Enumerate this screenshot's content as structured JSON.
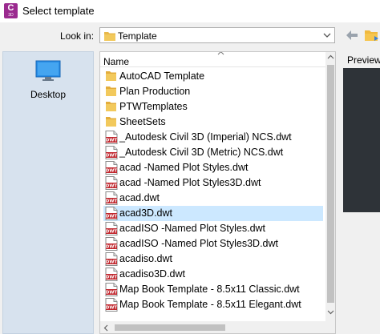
{
  "window": {
    "title": "Select template",
    "app_icon_letter": "C",
    "app_icon_sub": "3D"
  },
  "toolbar": {
    "lookin_label": "Look in:",
    "lookin_value": "Template",
    "back_icon": "back-arrow-icon",
    "up_icon": "folder-up-icon"
  },
  "places": {
    "items": [
      {
        "label": "Desktop",
        "icon": "desktop-icon"
      }
    ]
  },
  "filelist": {
    "column_header": "Name",
    "selected_index": 9,
    "items": [
      {
        "label": "AutoCAD Template",
        "type": "folder"
      },
      {
        "label": "Plan Production",
        "type": "folder"
      },
      {
        "label": "PTWTemplates",
        "type": "folder"
      },
      {
        "label": "SheetSets",
        "type": "folder"
      },
      {
        "label": "_Autodesk Civil 3D (Imperial) NCS.dwt",
        "type": "dwt"
      },
      {
        "label": "_Autodesk Civil 3D (Metric) NCS.dwt",
        "type": "dwt"
      },
      {
        "label": "acad -Named Plot Styles.dwt",
        "type": "dwt"
      },
      {
        "label": "acad -Named Plot Styles3D.dwt",
        "type": "dwt"
      },
      {
        "label": "acad.dwt",
        "type": "dwt"
      },
      {
        "label": "acad3D.dwt",
        "type": "dwt"
      },
      {
        "label": "acadISO -Named Plot Styles.dwt",
        "type": "dwt"
      },
      {
        "label": "acadISO -Named Plot Styles3D.dwt",
        "type": "dwt"
      },
      {
        "label": "acadiso.dwt",
        "type": "dwt"
      },
      {
        "label": "acadiso3D.dwt",
        "type": "dwt"
      },
      {
        "label": "Map Book Template - 8.5x11 Classic.dwt",
        "type": "dwt"
      },
      {
        "label": "Map Book Template - 8.5x11 Elegant.dwt",
        "type": "dwt"
      }
    ]
  },
  "preview": {
    "label": "Preview"
  },
  "colors": {
    "accent_selected": "#cce8ff",
    "places_bg": "#d7e2ee",
    "folder": "#e8b84a",
    "dwt_red": "#c0262d",
    "preview_bg": "#2e3338"
  }
}
